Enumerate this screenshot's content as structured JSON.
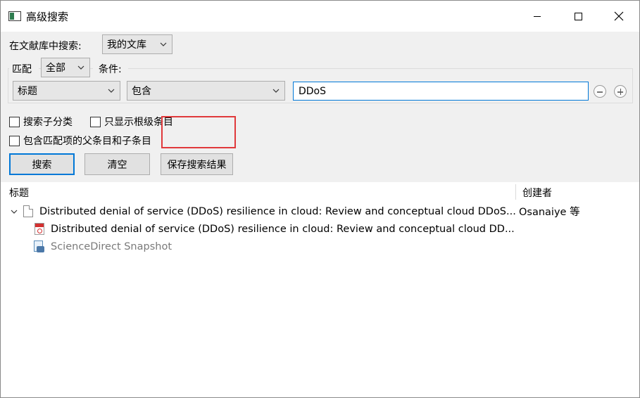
{
  "window": {
    "title": "高级搜索"
  },
  "search": {
    "in_library_label": "在文献库中搜索:",
    "library_value": "我的文库",
    "match_label": "匹配",
    "match_value": "全部",
    "conditions_label": "条件:",
    "field_value": "标题",
    "operator_value": "包含",
    "query_value": "DDoS"
  },
  "options": {
    "search_subcollections": "搜索子分类",
    "show_only_top_level": "只显示根级条目",
    "include_parent_and_child": "包含匹配项的父条目和子条目"
  },
  "buttons": {
    "search": "搜索",
    "clear": "清空",
    "save_search": "保存搜索结果"
  },
  "results": {
    "columns": [
      "标题",
      "创建者"
    ],
    "rows": [
      {
        "title": "Distributed denial of service (DDoS) resilience in cloud: Review and conceptual cloud DDoS...",
        "creator": "Osanaiye 等",
        "type": "journal-article",
        "expanded": true
      },
      {
        "title": "Distributed denial of service (DDoS) resilience in cloud: Review and conceptual cloud DD...",
        "type": "pdf-attachment"
      },
      {
        "title": "ScienceDirect Snapshot",
        "type": "snapshot-attachment"
      }
    ]
  },
  "colors": {
    "accent": "#0078d7",
    "highlight": "#e0393b",
    "panel": "#f0f0f0"
  }
}
